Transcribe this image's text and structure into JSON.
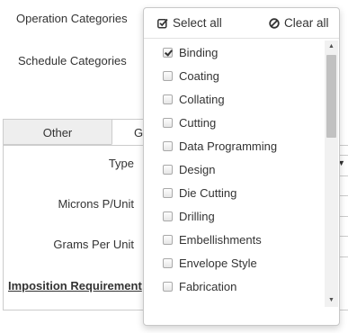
{
  "form": {
    "operation_categories_label": "Operation Categories",
    "schedule_categories_label": "Schedule Categories"
  },
  "tabs": {
    "other_label": "Other",
    "active_label": "G"
  },
  "fields": {
    "type_label": "Type",
    "microns_label": "Microns P/Unit",
    "grams_label": "Grams Per Unit",
    "imposition_label": "Imposition Requirement"
  },
  "dropdown": {
    "select_all_label": "Select all",
    "clear_all_label": "Clear all",
    "items": [
      {
        "label": "Binding",
        "checked": true
      },
      {
        "label": "Coating",
        "checked": false
      },
      {
        "label": "Collating",
        "checked": false
      },
      {
        "label": "Cutting",
        "checked": false
      },
      {
        "label": "Data Programming",
        "checked": false
      },
      {
        "label": "Design",
        "checked": false
      },
      {
        "label": "Die Cutting",
        "checked": false
      },
      {
        "label": "Drilling",
        "checked": false
      },
      {
        "label": "Embellishments",
        "checked": false
      },
      {
        "label": "Envelope Style",
        "checked": false
      },
      {
        "label": "Fabrication",
        "checked": false
      }
    ]
  },
  "icons": {
    "select_all": "checkbox-check-icon",
    "clear_all": "ban-icon",
    "caret": "caret-down-icon"
  }
}
